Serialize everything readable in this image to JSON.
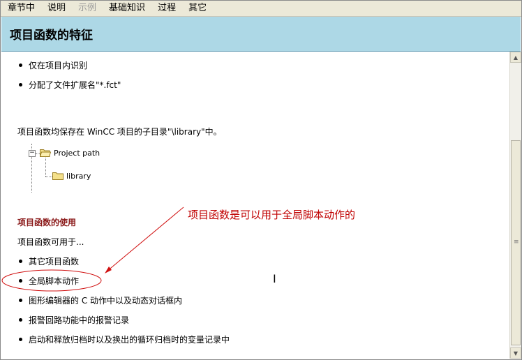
{
  "menu": {
    "items": [
      {
        "label": "章节中",
        "enabled": true
      },
      {
        "label": "说明",
        "enabled": true
      },
      {
        "label": "示例",
        "enabled": false
      },
      {
        "label": "基础知识",
        "enabled": true
      },
      {
        "label": "过程",
        "enabled": true
      },
      {
        "label": "其它",
        "enabled": true
      }
    ]
  },
  "header": {
    "title": "项目函数的特征"
  },
  "features": {
    "items": [
      "仅在项目内识别",
      "分配了文件扩展名\"*.fct\""
    ]
  },
  "storage_text": "项目函数均保存在 WinCC 项目的子目录\"\\library\"中。",
  "tree": {
    "root_label": "Project path",
    "child_label": "library"
  },
  "usage": {
    "heading": "项目函数的使用",
    "intro": "项目函数可用于...",
    "items": [
      "其它项目函数",
      "全局脚本动作",
      "图形编辑器的 C 动作中以及动态对话框内",
      "报警回路功能中的报警记录",
      "启动和释放归档时以及换出的循环归档时的变量记录中"
    ]
  },
  "annotation": {
    "text": "项目函数是可以用于全局脚本动作的",
    "color": "#c00000"
  },
  "colors": {
    "header_bg": "#add8e6",
    "heading_red": "#8b1a1a"
  }
}
